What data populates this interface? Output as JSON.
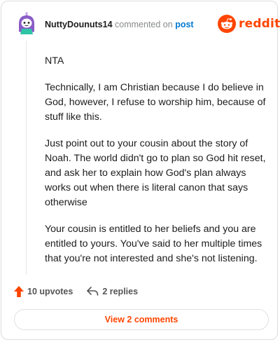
{
  "header": {
    "username": "NuttyDounuts14",
    "commented_text": "commented on",
    "post_link": "post",
    "brand": "reddit"
  },
  "comment": {
    "paragraphs": [
      "NTA",
      "Technically, I am Christian because I do believe in God, however, I refuse to worship him, because of stuff like this.",
      "Just point out to your cousin about the story of Noah. The world didn't go to plan so God hit reset, and ask her to explain how God's plan always works out when there is literal canon that says otherwise",
      "Your cousin is entitled to her beliefs and you are entitled to yours. You've said to her multiple times that you're not interested and she's not listening."
    ]
  },
  "actions": {
    "upvotes_label": "10 upvotes",
    "replies_label": "2 replies",
    "view_comments_label": "View 2 comments"
  },
  "colors": {
    "brand_orange": "#ff4500",
    "link_blue": "#0079d3",
    "muted_gray": "#878a8c"
  }
}
